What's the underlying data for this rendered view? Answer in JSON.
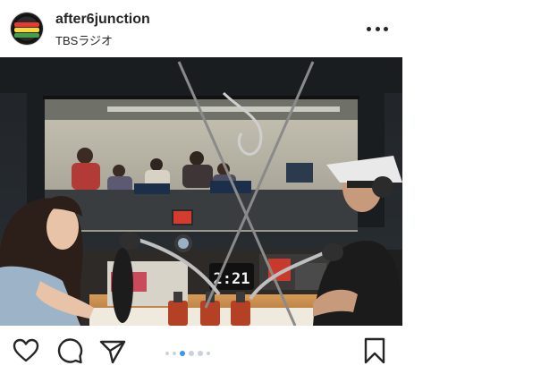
{
  "post": {
    "username": "after6junction",
    "location": "TBSラジオ"
  },
  "photo": {
    "clock_display": "2:21"
  },
  "carousel": {
    "active_index": 1,
    "dot_count": 6
  },
  "colors": {
    "accent": "#3897f0",
    "text": "#262626"
  },
  "icons": {
    "more": "more-options-icon",
    "like": "heart-icon",
    "comment": "comment-icon",
    "share": "direct-share-icon",
    "save": "bookmark-icon"
  }
}
